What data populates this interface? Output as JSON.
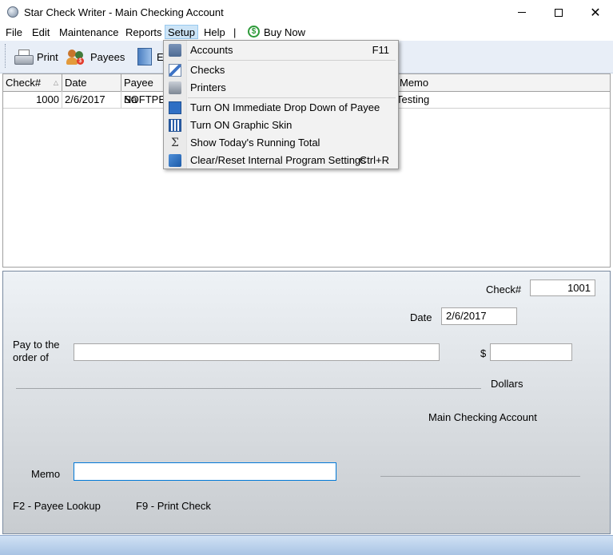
{
  "window": {
    "title": "Star Check Writer - Main Checking Account",
    "minimize": "—",
    "maximize": "☐",
    "close": "✕"
  },
  "menubar": {
    "items": [
      "File",
      "Edit",
      "Maintenance",
      "Reports",
      "Setup",
      "Help"
    ],
    "separator": "|",
    "buy_now": "Buy Now",
    "buy_now_icon": "dollar-icon",
    "active": "Setup"
  },
  "toolbar": {
    "print_label": "Print",
    "payees_label": "Payees",
    "exit_label": "E"
  },
  "grid": {
    "columns": [
      "Check#",
      "Date",
      "Payee Na",
      "Memo"
    ],
    "rows": [
      {
        "check": "1000",
        "date": "2/6/2017",
        "payee": "SOFTPED",
        "memo": "Testing"
      }
    ]
  },
  "check_form": {
    "check_label": "Check#",
    "check_value": "1001",
    "date_label": "Date",
    "date_value": "2/6/2017",
    "pay_to_line1": "Pay to the",
    "pay_to_line2": "order of",
    "payee_value": "",
    "dollar_sign": "$",
    "amount_value": "",
    "dollars_label": "Dollars",
    "account_name": "Main Checking Account",
    "memo_label": "Memo",
    "memo_value": "",
    "hint_payee": "F2 - Payee Lookup",
    "hint_print": "F9 - Print Check"
  },
  "setup_menu": {
    "items": [
      {
        "label": "Accounts",
        "shortcut": "F11",
        "icon": "accounts-icon"
      },
      {
        "label": "Checks",
        "shortcut": "",
        "icon": "checks-icon"
      },
      {
        "label": "Printers",
        "shortcut": "",
        "icon": "printers-icon"
      },
      {
        "label": "Turn ON Immediate Drop Down of Payee",
        "shortcut": "",
        "icon": "dropdown-icon"
      },
      {
        "label": "Turn ON Graphic Skin",
        "shortcut": "",
        "icon": "skin-icon"
      },
      {
        "label": "Show Today's Running Total",
        "shortcut": "",
        "icon": "sigma-icon"
      },
      {
        "label": "Clear/Reset Internal Program Settings",
        "shortcut": "Ctrl+R",
        "icon": "reset-icon"
      }
    ]
  },
  "watermark": "SOFTPEDIA",
  "colors": {
    "menu_highlight": "#cce4f7",
    "toolbar_bg": "#e8eef7",
    "panel_top": "#eef2f6",
    "panel_bottom": "#c8ccd0",
    "status_bar": "#a9c4e4"
  }
}
